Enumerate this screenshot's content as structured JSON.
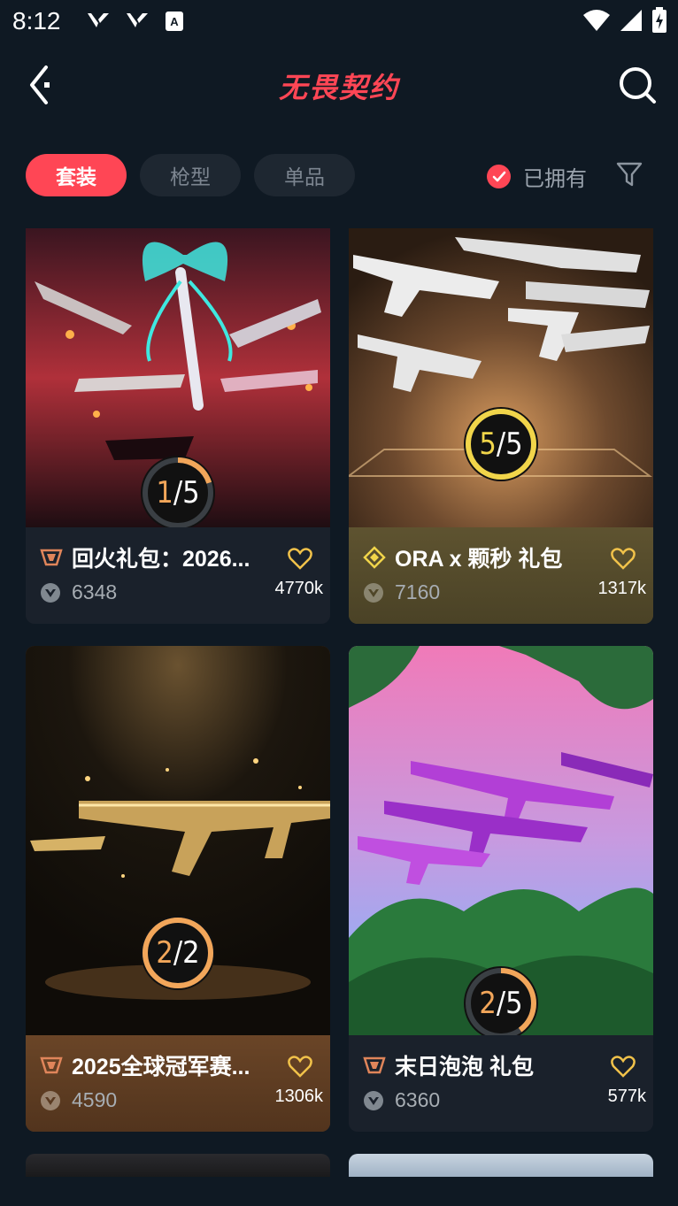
{
  "status_bar": {
    "time": "8:12"
  },
  "header": {
    "logo_text": "无畏契约"
  },
  "tabs": [
    {
      "label": "套装",
      "active": true
    },
    {
      "label": "枪型",
      "active": false
    },
    {
      "label": "单品",
      "active": false
    }
  ],
  "owned_filter": {
    "label": "已拥有",
    "checked": true
  },
  "colors": {
    "accent": "#ff4655",
    "background": "#0f1923",
    "ring_orange": "#f2a65a",
    "ring_gold": "#f1d54a"
  },
  "bundles": [
    {
      "title": "回火礼包：2026...",
      "price": "6348",
      "likes": "4770k",
      "owned": 1,
      "total": 5,
      "tier_icon": "premium-tier-icon"
    },
    {
      "title": "ORA x 颗秒 礼包",
      "price": "7160",
      "likes": "1317k",
      "owned": 5,
      "total": 5,
      "tier_icon": "deluxe-tier-icon"
    },
    {
      "title": "2025全球冠军赛...",
      "price": "4590",
      "likes": "1306k",
      "owned": 2,
      "total": 2,
      "tier_icon": "premium-tier-icon"
    },
    {
      "title": "末日泡泡 礼包",
      "price": "6360",
      "likes": "577k",
      "owned": 2,
      "total": 5,
      "tier_icon": "premium-tier-icon"
    }
  ]
}
